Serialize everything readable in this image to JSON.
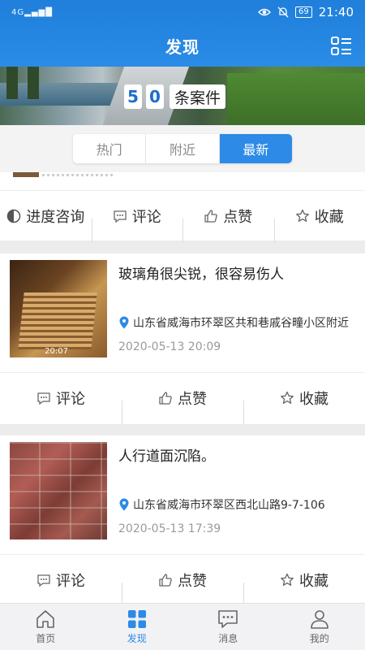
{
  "status_bar": {
    "network": "4G",
    "battery": "69",
    "time": "21:40"
  },
  "header": {
    "title": "发现"
  },
  "banner": {
    "count_digits": [
      "5",
      "0"
    ],
    "count_unit": "条案件"
  },
  "tabs": [
    {
      "label": "热门",
      "active": false
    },
    {
      "label": "附近",
      "active": false
    },
    {
      "label": "最新",
      "active": true
    }
  ],
  "cards": [
    {
      "actions": [
        {
          "label": "进度咨询",
          "icon": "progress-icon"
        },
        {
          "label": "评论",
          "icon": "comment-icon"
        },
        {
          "label": "点赞",
          "icon": "like-icon"
        },
        {
          "label": "收藏",
          "icon": "star-icon"
        }
      ]
    },
    {
      "title": "玻璃角很尖锐，很容易伤人",
      "location": "山东省威海市环翠区共和巷戚谷疃小区附近",
      "time": "2020-05-13 20:09",
      "video_duration": "20:07",
      "actions": [
        {
          "label": "评论",
          "icon": "comment-icon"
        },
        {
          "label": "点赞",
          "icon": "like-icon"
        },
        {
          "label": "收藏",
          "icon": "star-icon"
        }
      ]
    },
    {
      "title": "人行道面沉陷。",
      "location": "山东省威海市环翠区西北山路9-7-106",
      "time": "2020-05-13 17:39",
      "actions": [
        {
          "label": "评论",
          "icon": "comment-icon"
        },
        {
          "label": "点赞",
          "icon": "like-icon"
        },
        {
          "label": "收藏",
          "icon": "star-icon"
        }
      ]
    }
  ],
  "bottom_nav": [
    {
      "label": "首页",
      "icon": "home-icon",
      "active": false
    },
    {
      "label": "发现",
      "icon": "discover-grid-icon",
      "active": true
    },
    {
      "label": "消息",
      "icon": "message-icon",
      "active": false
    },
    {
      "label": "我的",
      "icon": "profile-icon",
      "active": false
    }
  ],
  "colors": {
    "primary": "#2d8ae6",
    "header": "#1f7fdb"
  }
}
